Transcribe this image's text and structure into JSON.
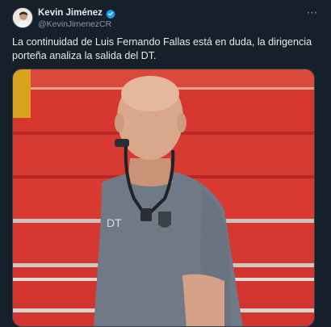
{
  "author": {
    "display_name": "Kevin Jiménez",
    "handle": "@KevinJimenezCR",
    "verified_icon": "verified-badge-icon",
    "avatar_icon": "avatar"
  },
  "more_icon": "more-horizontal-icon",
  "tweet": {
    "text": "La continuidad de Luis Fernando Fallas está en duda, la dirigencia porteña analiza la salida del DT."
  },
  "media": {
    "kind": "photo",
    "colors": {
      "stands_red": "#d7372f",
      "shirt_gray": "#6f7785",
      "skin": "#d9a88c",
      "background": "#15202b",
      "accent_verified": "#1d9bf0"
    }
  }
}
